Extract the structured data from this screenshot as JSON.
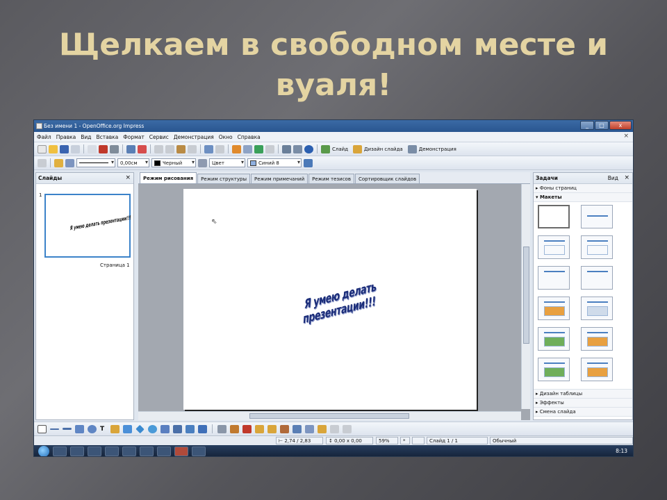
{
  "slide": {
    "title_line1": "Щелкаем в свободном месте и",
    "title_line2": "вуаля!"
  },
  "window": {
    "title": "Без имени 1 - OpenOffice.org Impress",
    "buttons": [
      "_",
      "□",
      "x"
    ]
  },
  "menu": [
    "Файл",
    "Правка",
    "Вид",
    "Вставка",
    "Формат",
    "Сервис",
    "Демонстрация",
    "Окно",
    "Справка"
  ],
  "toolbar1": {
    "slide_btn": "Слайд",
    "design_btn": "Дизайн слайда",
    "demo_btn": "Демонстрация"
  },
  "toolbar2": {
    "line_width": "0,00см",
    "line_color": "Черный",
    "fill_type": "Цвет",
    "fill_color": "Синий 8"
  },
  "slides_panel": {
    "title": "Слайды",
    "slide_number": "1",
    "slide_caption": "Страница 1",
    "thumb_text": "Я умею делать презентации!!!"
  },
  "tabs": [
    "Режим рисования",
    "Режим структуры",
    "Режим примечаний",
    "Режим тезисов",
    "Сортировщик слайдов"
  ],
  "canvas": {
    "fontwork_text": "Я умею делать презентации!!!"
  },
  "tasks_panel": {
    "title": "Задачи",
    "view": "Вид",
    "sections": {
      "backgrounds": "Фоны страниц",
      "layouts": "Макеты",
      "table_design": "Дизайн таблицы",
      "effects": "Эффекты",
      "transition": "Смена слайда"
    }
  },
  "status": {
    "position": "2,74 / 2,83",
    "size": "0,00 x 0,00",
    "zoom": "59%",
    "star": "*",
    "slide": "Слайд 1 / 1",
    "layout": "Обычный"
  },
  "taskbar": {
    "clock": "8:13"
  },
  "colors": {
    "title_gold": "#e4d4a2",
    "fontwork_blue": "#1a2c78",
    "window_blue": "#2a5690"
  }
}
